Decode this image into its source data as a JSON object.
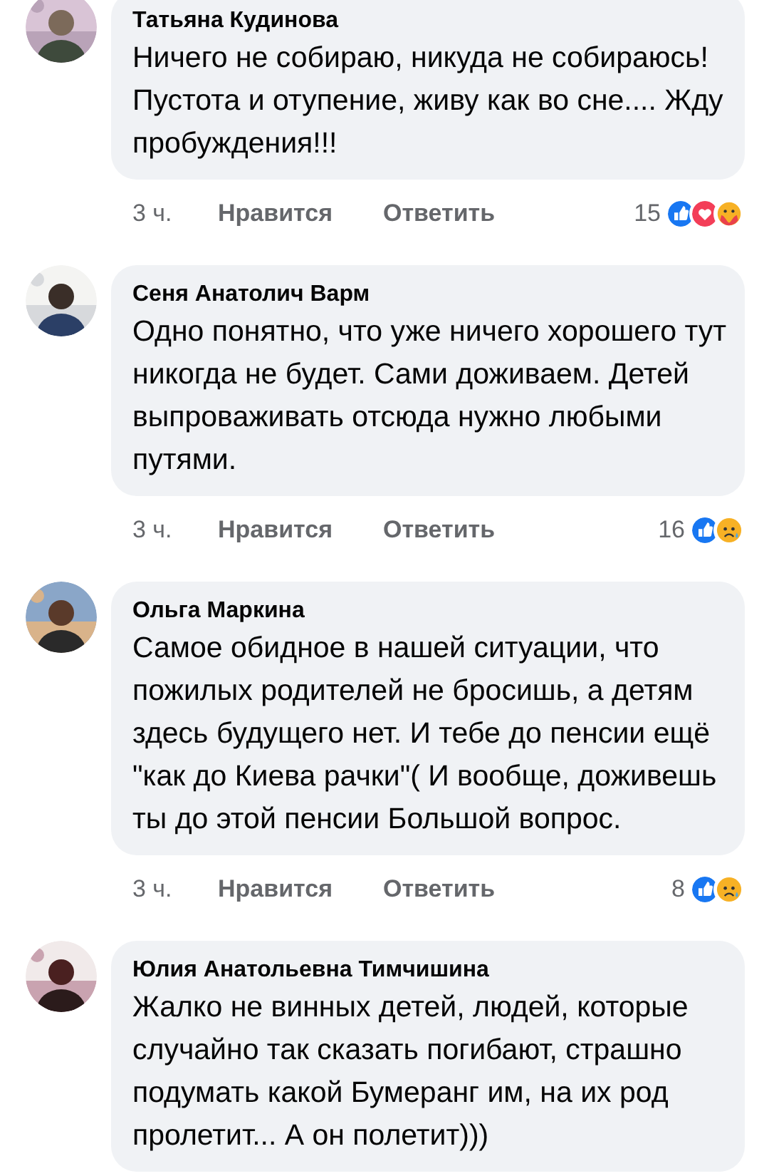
{
  "comments": [
    {
      "author": "Татьяна Кудинова",
      "text": "Ничего не собираю, никуда не собираюсь! Пустота и отупение, живу как во сне.... Жду пробуждения!!!",
      "time": "3 ч.",
      "like": "Нравится",
      "reply": "Ответить",
      "reaction_count": "15",
      "reactions": [
        {
          "kind": "like"
        },
        {
          "kind": "love"
        },
        {
          "kind": "care"
        }
      ]
    },
    {
      "author": "Сеня Анатолич Варм",
      "text": "Одно понятно, что уже ничего хорошего тут никогда не будет. Сами доживаем. Детей выпроваживать отсюда нужно любыми путями.",
      "time": "3 ч.",
      "like": "Нравится",
      "reply": "Ответить",
      "reaction_count": "16",
      "reactions": [
        {
          "kind": "like"
        },
        {
          "kind": "sad"
        }
      ]
    },
    {
      "author": "Ольга Маркина",
      "text": "Самое обидное в нашей ситуации, что пожилых родителей не бросишь, а детям здесь будущего нет. И тебе до пенсии ещё \"как до Киева рачки\"(  И вообще, доживешь ты до этой пенсии Большой вопрос.",
      "time": "3 ч.",
      "like": "Нравится",
      "reply": "Ответить",
      "reaction_count": "8",
      "reactions": [
        {
          "kind": "like"
        },
        {
          "kind": "sad"
        }
      ]
    },
    {
      "author": "Юлия Анатольевна Тимчишина",
      "text": "Жалко не винных детей, людей, которые случайно так сказать погибают, страшно подумать какой Бумеранг им, на их род пролетит... А он полетит)))"
    }
  ]
}
